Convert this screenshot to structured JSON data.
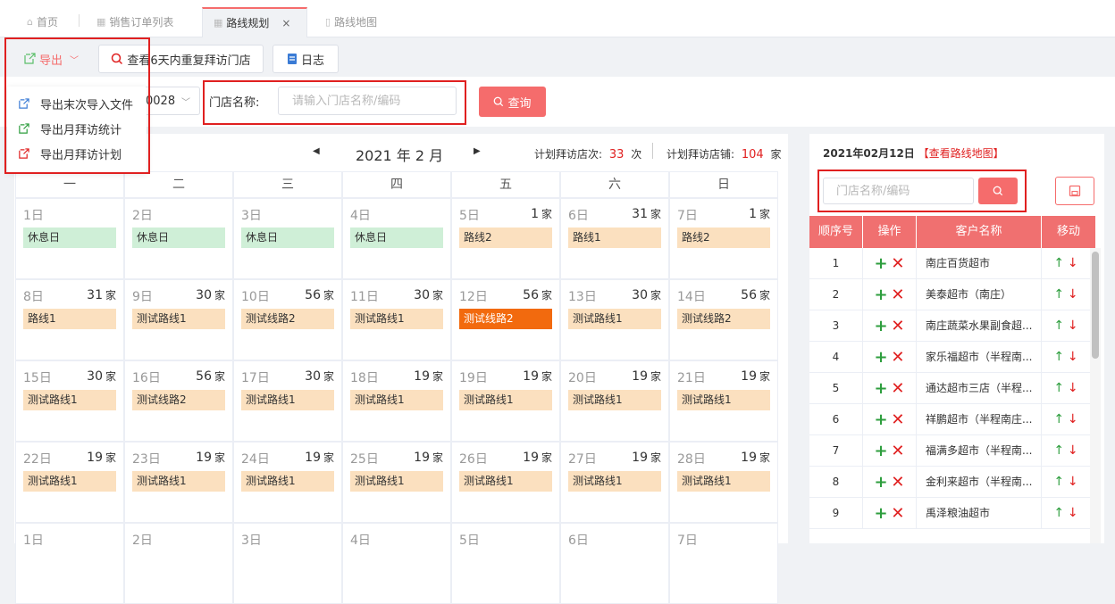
{
  "tabs": [
    {
      "label": "首页",
      "icon": "home-icon"
    },
    {
      "label": "销售订单列表",
      "icon": "grid-icon"
    },
    {
      "label": "路线规划",
      "icon": "grid-icon"
    },
    {
      "label": "路线地图",
      "icon": "doc-icon"
    }
  ],
  "tab_close": "×",
  "toolbar": {
    "export_label": "导出",
    "check_repeat_label": "查看6天内重复拜访门店",
    "log_label": "日志"
  },
  "export_menu": [
    "导出末次导入文件",
    "导出月拜访统计",
    "导出月拜访计划"
  ],
  "filters": {
    "select_value": "0028",
    "store_label": "门店名称:",
    "store_placeholder": "请输入门店名称/编码",
    "query_label": "查询"
  },
  "calendar": {
    "title": "2021 年 2 月",
    "prev": "◀",
    "next": "▶",
    "visits_label": "计划拜访店次:",
    "visits_value": "33",
    "visits_unit": "次",
    "stores_label": "计划拜访店铺:",
    "stores_value": "104",
    "stores_unit": "家",
    "weekdays": [
      "一",
      "二",
      "三",
      "四",
      "五",
      "六",
      "日"
    ],
    "unit": "家",
    "days": [
      {
        "d": "1日",
        "c": "",
        "tag": "休息日",
        "t": "green"
      },
      {
        "d": "2日",
        "c": "",
        "tag": "休息日",
        "t": "green"
      },
      {
        "d": "3日",
        "c": "",
        "tag": "休息日",
        "t": "green"
      },
      {
        "d": "4日",
        "c": "",
        "tag": "休息日",
        "t": "green"
      },
      {
        "d": "5日",
        "c": "1",
        "tag": "路线2",
        "t": "peach"
      },
      {
        "d": "6日",
        "c": "31",
        "tag": "路线1",
        "t": "peach"
      },
      {
        "d": "7日",
        "c": "1",
        "tag": "路线2",
        "t": "peach"
      },
      {
        "d": "8日",
        "c": "31",
        "tag": "路线1",
        "t": "peach"
      },
      {
        "d": "9日",
        "c": "30",
        "tag": "测试路线1",
        "t": "peach"
      },
      {
        "d": "10日",
        "c": "56",
        "tag": "测试线路2",
        "t": "peach"
      },
      {
        "d": "11日",
        "c": "30",
        "tag": "测试路线1",
        "t": "peach"
      },
      {
        "d": "12日",
        "c": "56",
        "tag": "测试线路2",
        "t": "orange"
      },
      {
        "d": "13日",
        "c": "30",
        "tag": "测试路线1",
        "t": "peach"
      },
      {
        "d": "14日",
        "c": "56",
        "tag": "测试线路2",
        "t": "peach"
      },
      {
        "d": "15日",
        "c": "30",
        "tag": "测试路线1",
        "t": "peach"
      },
      {
        "d": "16日",
        "c": "56",
        "tag": "测试线路2",
        "t": "peach"
      },
      {
        "d": "17日",
        "c": "30",
        "tag": "测试路线1",
        "t": "peach"
      },
      {
        "d": "18日",
        "c": "19",
        "tag": "测试路线1",
        "t": "peach"
      },
      {
        "d": "19日",
        "c": "19",
        "tag": "测试路线1",
        "t": "peach"
      },
      {
        "d": "20日",
        "c": "19",
        "tag": "测试路线1",
        "t": "peach"
      },
      {
        "d": "21日",
        "c": "19",
        "tag": "测试路线1",
        "t": "peach"
      },
      {
        "d": "22日",
        "c": "19",
        "tag": "测试路线1",
        "t": "peach"
      },
      {
        "d": "23日",
        "c": "19",
        "tag": "测试路线1",
        "t": "peach"
      },
      {
        "d": "24日",
        "c": "19",
        "tag": "测试路线1",
        "t": "peach"
      },
      {
        "d": "25日",
        "c": "19",
        "tag": "测试路线1",
        "t": "peach"
      },
      {
        "d": "26日",
        "c": "19",
        "tag": "测试路线1",
        "t": "peach"
      },
      {
        "d": "27日",
        "c": "19",
        "tag": "测试路线1",
        "t": "peach"
      },
      {
        "d": "28日",
        "c": "19",
        "tag": "测试路线1",
        "t": "peach"
      },
      {
        "d": "1日",
        "c": "",
        "tag": "",
        "t": ""
      },
      {
        "d": "2日",
        "c": "",
        "tag": "",
        "t": ""
      },
      {
        "d": "3日",
        "c": "",
        "tag": "",
        "t": ""
      },
      {
        "d": "4日",
        "c": "",
        "tag": "",
        "t": ""
      },
      {
        "d": "5日",
        "c": "",
        "tag": "",
        "t": ""
      },
      {
        "d": "6日",
        "c": "",
        "tag": "",
        "t": ""
      },
      {
        "d": "7日",
        "c": "",
        "tag": "",
        "t": ""
      }
    ]
  },
  "side": {
    "date": "2021年02月12日",
    "map_link": "【查看路线地图】",
    "search_placeholder": "门店名称/编码",
    "headers": [
      "顺序号",
      "操作",
      "客户名称",
      "移动"
    ],
    "rows": [
      {
        "n": "1",
        "name": "南庄百货超市"
      },
      {
        "n": "2",
        "name": "美泰超市（南庄）"
      },
      {
        "n": "3",
        "name": "南庄蔬菜水果副食超..."
      },
      {
        "n": "4",
        "name": "家乐福超市（半程南..."
      },
      {
        "n": "5",
        "name": "通达超市三店（半程..."
      },
      {
        "n": "6",
        "name": "祥鹏超市（半程南庄..."
      },
      {
        "n": "7",
        "name": "福满多超市（半程南..."
      },
      {
        "n": "8",
        "name": "金利来超市（半程南..."
      },
      {
        "n": "9",
        "name": "禹泽粮油超市"
      }
    ]
  },
  "colors": {
    "accent": "#f56c6c",
    "highlight": "#f26a0e",
    "rest": "#cfefd7",
    "route": "#fbe0bf",
    "annotation": "#e02020"
  }
}
